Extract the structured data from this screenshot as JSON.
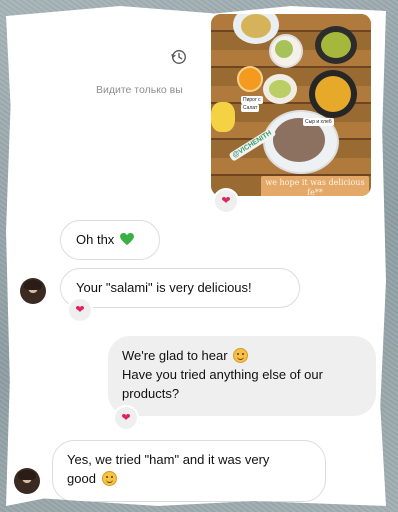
{
  "header": {
    "history_icon": "history-clock-icon",
    "only_you_label": "Видите только вы"
  },
  "story": {
    "mention": "@VICHENITH",
    "caption": "we hope it was delicious fe**",
    "labels": [
      "Пирог с",
      "Салат",
      "Сыр и хлеб"
    ],
    "reaction": "heart-icon"
  },
  "messages": [
    {
      "id": "m1",
      "sender": "other",
      "text": "Oh thx",
      "emoji": "green-heart-icon"
    },
    {
      "id": "m2",
      "sender": "other",
      "text": "Your \"salami\" is very delicious!",
      "reaction": "heart-icon"
    },
    {
      "id": "m3",
      "sender": "me",
      "line1": "We're glad to hear",
      "line1_emoji": "smiling-face-icon",
      "line2": "Have you tried anything else of our",
      "line3": "products?",
      "reaction": "heart-icon"
    },
    {
      "id": "m4",
      "sender": "other",
      "line1": "Yes, we tried \"ham\" and it was very",
      "line2": "good",
      "line2_emoji": "grinning-face-icon"
    }
  ],
  "colors": {
    "heart": "#e0245e",
    "green_heart": "#3cb043",
    "bubble_mine": "#efefef",
    "bubble_theirs_border": "#dcdcdc"
  }
}
